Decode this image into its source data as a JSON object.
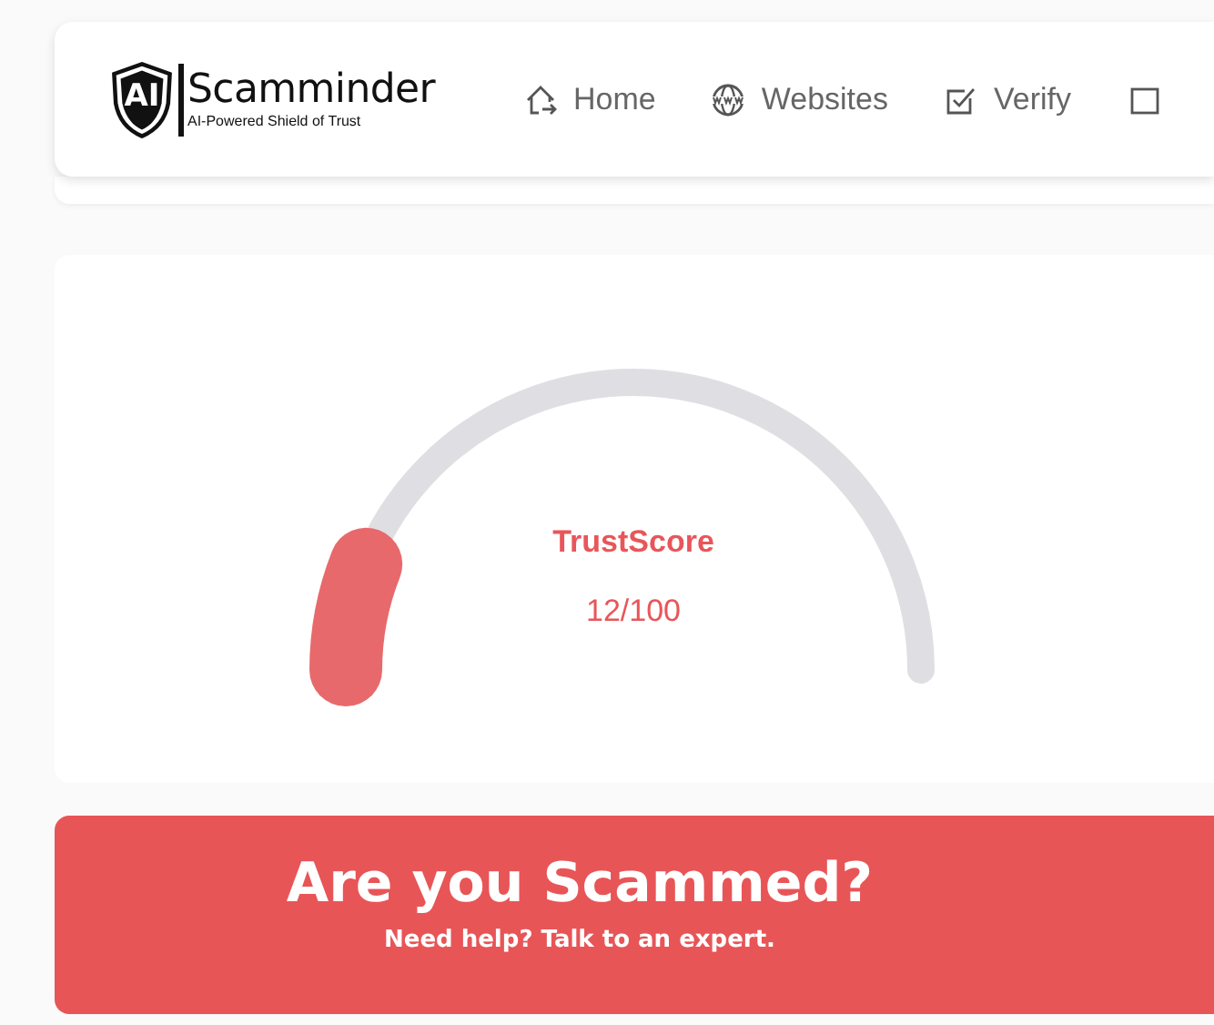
{
  "header": {
    "logo": {
      "mark": "AI",
      "name": "Scamminder",
      "tagline": "AI-Powered Shield of Trust"
    },
    "nav": [
      {
        "label": "Home",
        "kind": "home"
      },
      {
        "label": "Websites",
        "kind": "www"
      },
      {
        "label": "Verify",
        "kind": "check"
      },
      {
        "kind": "square"
      }
    ]
  },
  "gauge": {
    "label": "TrustScore",
    "value": "12/100"
  },
  "banner": {
    "title": "Are you Scammed?",
    "subtitle": "Need help? Talk to an expert."
  }
}
